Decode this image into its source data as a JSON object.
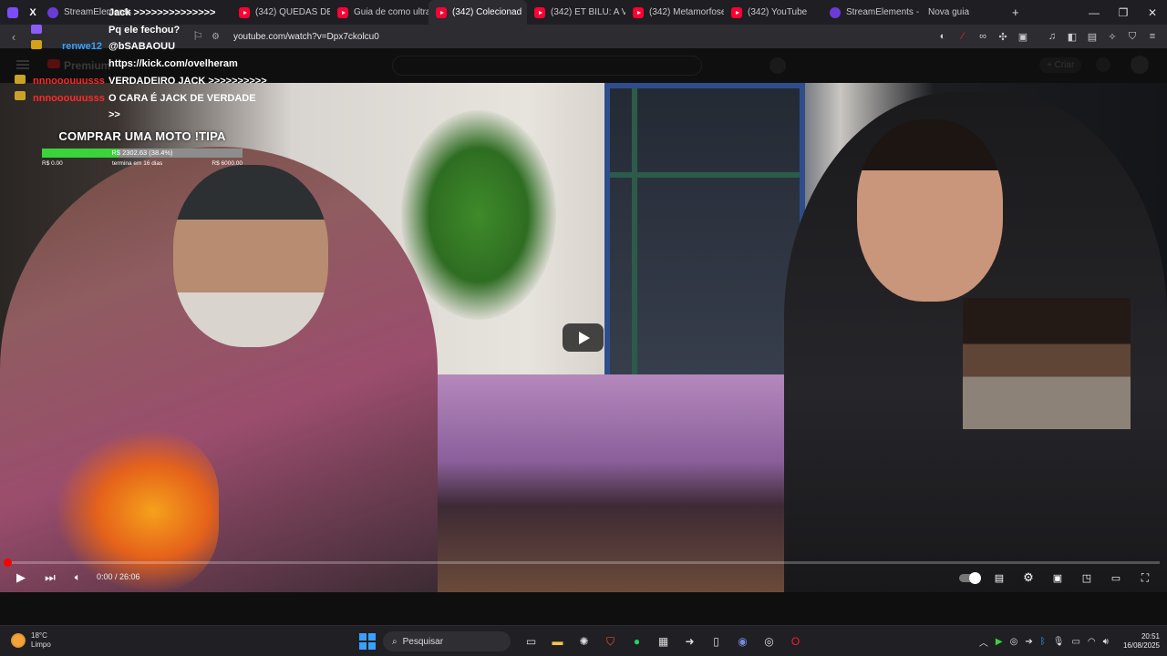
{
  "browser": {
    "tabs": [
      {
        "label": "",
        "icon": "twitch-icon",
        "active": false
      },
      {
        "label": "",
        "icon": "x-icon",
        "active": false
      },
      {
        "label": "StreamElements",
        "icon": "streamelements-icon",
        "active": false
      },
      {
        "label": "(342) QUEDAS DE MC",
        "icon": "youtube-icon",
        "active": false
      },
      {
        "label": "Guia de como ultrapa",
        "icon": "youtube-icon",
        "active": false
      },
      {
        "label": "(342) Colecionad",
        "icon": "youtube-icon",
        "active": true
      },
      {
        "label": "(342) ET BILU: A VERD",
        "icon": "youtube-icon",
        "active": false
      },
      {
        "label": "(342) Metamorfose A",
        "icon": "youtube-icon",
        "active": false
      },
      {
        "label": "(342) YouTube",
        "icon": "youtube-icon",
        "active": false
      },
      {
        "label": "StreamElements - My",
        "icon": "streamelements-icon",
        "active": false
      },
      {
        "label": "Nova guia",
        "icon": "",
        "active": false
      }
    ],
    "new_tab_label": "+",
    "url": "youtube.com/watch?v=Dpx7ckolcu0",
    "brave_badge": "1"
  },
  "youtube": {
    "brand": "Premium",
    "create_label": "+ Criar"
  },
  "chat": {
    "messages": [
      {
        "user": "Jack >>>>>>>>>>>>>>",
        "text": "",
        "user_color": "#ffffff"
      },
      {
        "user": "",
        "text": "Pq ele fechou?",
        "user_color": "#ff2a2a"
      },
      {
        "user": "renwe12",
        "text": "@bSABAOUU",
        "user_color": "#3aa0ff"
      },
      {
        "user": "",
        "text": "https://kick.com/ovelheram",
        "user_color": "#ff2a2a"
      },
      {
        "user": "nnnooouuusss",
        "text": "VERDADEIRO JACK >>>>>>>>>>",
        "user_color": "#ff2a2a"
      },
      {
        "user": "nnnooouuusss",
        "text": "O CARA É JACK DE VERDADE",
        "user_color": "#ff2a2a"
      },
      {
        "user": "",
        "text": ">>",
        "user_color": "#ffffff"
      }
    ]
  },
  "goal": {
    "title": "COMPRAR UMA MOTO !TIPA",
    "progress_text": "R$ 2302.63 (38.4%)",
    "progress_fraction": 0.384,
    "start_label": "R$ 0.00",
    "ends_label": "termina em 16 dias",
    "target_label": "R$ 6000.00"
  },
  "player": {
    "time": "0:00 / 26:06",
    "progress_fraction": 0.0
  },
  "taskbar": {
    "temperature": "18°C",
    "condition": "Limpo",
    "search_placeholder": "Pesquisar",
    "time": "20:51",
    "date": "16/08/2025"
  }
}
